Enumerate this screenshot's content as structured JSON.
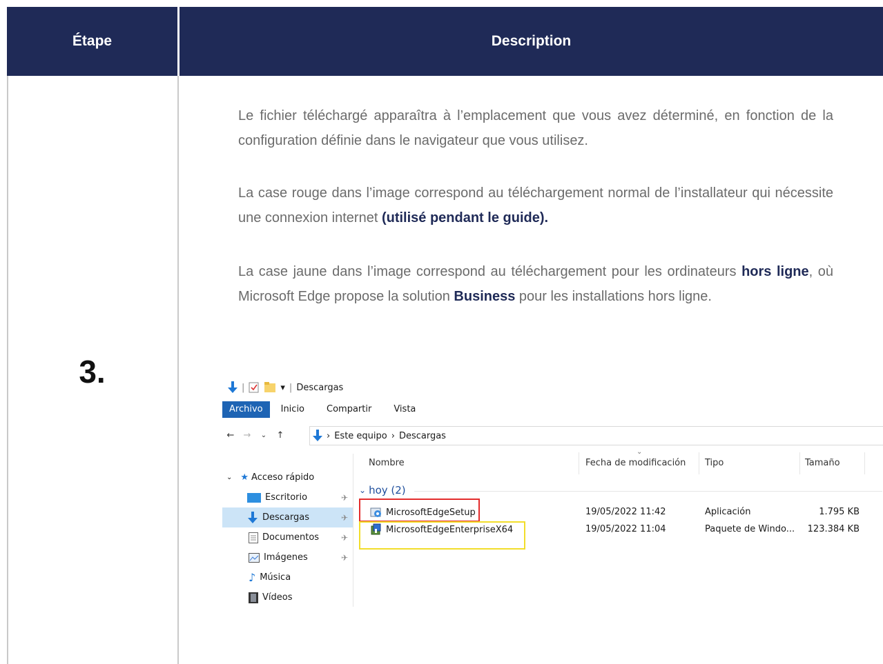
{
  "table": {
    "header_step": "Étape",
    "header_description": "Description",
    "step_number": "3."
  },
  "content": {
    "p1": "Le fichier téléchargé apparaîtra à l’emplacement que vous avez déterminé, en fonction de la configuration définie dans le navigateur que vous utilisez.",
    "p2_text": "La case rouge dans l’image correspond au téléchargement normal de l’installateur qui nécessite une connexion internet ",
    "p2_bold": "(utilisé pendant le guide).",
    "p3_a": "La case jaune dans l’image correspond au téléchargement pour les ordinateurs ",
    "p3_bold1": "hors ligne",
    "p3_b": ", où Microsoft Edge propose la solution ",
    "p3_bold2": "Business",
    "p3_c": " pour les installations hors ligne."
  },
  "explorer": {
    "window_title": "Descargas",
    "ribbon_tabs": [
      "Archivo",
      "Inicio",
      "Compartir",
      "Vista"
    ],
    "breadcrumb": [
      "Este equipo",
      "Descargas"
    ],
    "columns": [
      "Nombre",
      "Fecha de modificación",
      "Tipo",
      "Tamaño"
    ],
    "nav_header": "Acceso rápido",
    "nav_items": [
      "Escritorio",
      "Descargas",
      "Documentos",
      "Imágenes",
      "Música",
      "Vídeos"
    ],
    "group_label": "hoy (2)",
    "files": [
      {
        "name": "MicrosoftEdgeSetup",
        "date": "19/05/2022 11:42",
        "type": "Aplicación",
        "size": "1.795 KB"
      },
      {
        "name": "MicrosoftEdgeEnterpriseX64",
        "date": "19/05/2022 11:04",
        "type": "Paquete de Windo...",
        "size": "123.384 KB"
      }
    ],
    "colors": {
      "accent": "#1e64b4",
      "selected": "#cce4f7",
      "red_box": "#e32b2b",
      "yellow_box": "#f2dd2a"
    }
  },
  "colors": {
    "header_bg": "#1f2a57",
    "body_text": "#6b6b6b",
    "bold_text": "#1f2a57"
  }
}
